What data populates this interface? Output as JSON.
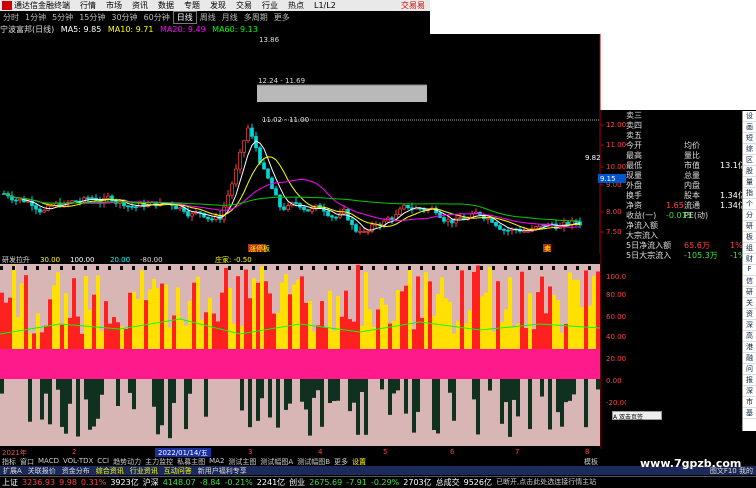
{
  "menu": {
    "app_title": "通达信金融终端",
    "items": [
      "行情",
      "市场",
      "资讯",
      "数据",
      "专题",
      "发现",
      "交易",
      "行业",
      "热点",
      "L1/L2"
    ],
    "trade_label": "交易易"
  },
  "periods": {
    "items": [
      "分时",
      "1分钟",
      "5分钟",
      "15分钟",
      "30分钟",
      "60分钟",
      "日线",
      "周线",
      "月线",
      "多周期",
      "更多"
    ],
    "selected": "日线"
  },
  "stock": {
    "title": "宁波富邦(日线)",
    "ma5": "MA5: 9.85",
    "ma10": "MA10: 9.71",
    "ma20": "MA20: 9.49",
    "ma60": "MA60: 9.13"
  },
  "price_annotations": {
    "high": "13.86",
    "box_label": "12.24 - 11.69",
    "box2_label": "11.02 - 11.00",
    "current": "9.82",
    "current_box": "9.15",
    "limit_up_tag": "涨停板",
    "sell_tag": "卖"
  },
  "price_axis": [
    "12.00",
    "11.00",
    "10.00",
    "9.00",
    "8.00",
    "7.50"
  ],
  "indicator": {
    "name": "研发拉升",
    "line1": "30.00",
    "line2": "100.00",
    "line3": "20.00",
    "line4": "-80.00",
    "tag": "庄家: -0.50"
  },
  "indicator_axis": [
    "100.00",
    "80.00",
    "60.00",
    "40.00",
    "20.00",
    "0.00",
    "-20.00"
  ],
  "date_axis": {
    "year": "2021年",
    "ticks": [
      "2",
      "3",
      "4",
      "5",
      "6",
      "7",
      "8"
    ],
    "cursor_date": "2022/01/14/五"
  },
  "quote_panel": {
    "rows": [
      {
        "k": "卖三",
        "v": ""
      },
      {
        "k": "卖四",
        "v": ""
      },
      {
        "k": "卖五",
        "v": ""
      },
      {
        "k": "今开",
        "v": "",
        "k2": "均价",
        "v2": ""
      },
      {
        "k": "最高",
        "v": "",
        "k2": "量比",
        "v2": ""
      },
      {
        "k": "最低",
        "v": "",
        "k2": "市值",
        "v2": "13.1亿"
      },
      {
        "k": "现量",
        "v": "",
        "k2": "总量",
        "v2": ""
      },
      {
        "k": "外盘",
        "v": "",
        "k2": "内盘",
        "v2": ""
      },
      {
        "k": "换手",
        "v": "",
        "k2": "股本",
        "v2": "1.34亿"
      },
      {
        "k": "净资",
        "v": "1.65",
        "k2": "流通",
        "v2": "1.34亿"
      },
      {
        "k": "收益(一)",
        "v": "-0.013",
        "k2": "PE(动)",
        "v2": ""
      },
      {
        "k": "净流入额",
        "v": ""
      },
      {
        "k": "大宗流入",
        "v": ""
      },
      {
        "k": "5日净流入额",
        "v": "65.6万",
        "v3": "1%"
      },
      {
        "k": "5日大宗流入",
        "v": "-105.3万",
        "v3": "-1%"
      }
    ]
  },
  "toolstrip": [
    "设",
    "画",
    "短",
    "综",
    "区",
    "股",
    "量",
    "指",
    "个",
    "分",
    "研",
    "板",
    "组",
    "财",
    "F",
    "信",
    "研",
    "关",
    "资",
    "深",
    "高",
    "港",
    "融",
    "问",
    "报",
    "深",
    "市",
    "基"
  ],
  "popup_label": "A 双击页签",
  "bottom_tabs": [
    "指标",
    "窗口",
    "MACD",
    "VOL-TDX",
    "CCI",
    "趋势动力",
    "主力监控",
    "私募主图",
    "MA2",
    "测试主图",
    "测试幅图A",
    "测试幅图B",
    "更多",
    "设置"
  ],
  "bottom_right_tab": "模板",
  "info_tabs": [
    "扩展A",
    "关联报价",
    "资金分布",
    "综合资讯",
    "行业资讯",
    "互动问答",
    "新用户福利专享"
  ],
  "info_right": "图文F10 我的",
  "status": {
    "sh_label": "上证",
    "sh_value": "3236.93",
    "sh_change": "9.98",
    "sh_pct": "0.31%",
    "sh_amount": "3923亿",
    "hs_label": "沪深",
    "hs_value": "4148.07",
    "hs_change": "-8.84",
    "hs_pct": "-0.21%",
    "hs_amount": "2241亿",
    "cy_label": "创业",
    "cy_value": "2675.69",
    "cy_change": "-7.91",
    "cy_pct": "-0.29%",
    "cy_amount": "2703亿",
    "total_label": "总成交",
    "total_amount": "9526亿",
    "message": "已断开,点击此处选连接行情主站"
  },
  "watermark": "www.7gpzb.com",
  "colors": {
    "up": "#ff4040",
    "down": "#40e040",
    "ma5": "#ffffff",
    "ma10": "#ffff00",
    "ma20": "#ff00ff",
    "ma60": "#00ff00"
  }
}
